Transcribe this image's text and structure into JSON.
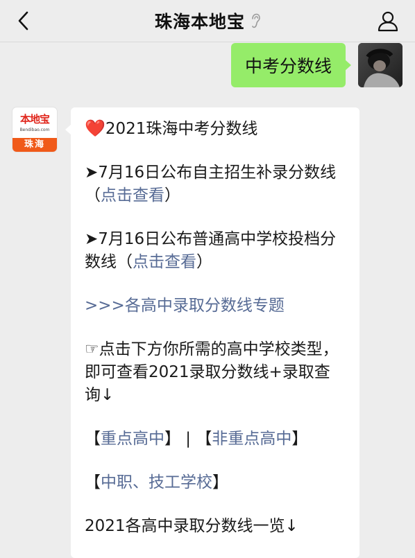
{
  "nav": {
    "title": "珠海本地宝",
    "back_icon": "chevron-left-icon",
    "ear_icon": "ear-icon",
    "profile_icon": "person-icon"
  },
  "outgoing": {
    "text": "中考分数线"
  },
  "bot": {
    "logo_top": "本地宝",
    "logo_url": "Bendibao.com",
    "logo_city": "珠海"
  },
  "message": {
    "heart": "❤️",
    "title": "2021珠海中考分数线",
    "item1_text": "➤7月16日公布自主招生补录分数线（",
    "item1_link": "点击查看",
    "item1_end": "）",
    "item2_text": "➤7月16日公布普通高中学校投档分数线（",
    "item2_link": "点击查看",
    "item2_end": "）",
    "topic_link": ">>>各高中录取分数线专题",
    "hint": "☞点击下方你所需的高中学校类型，即可查看2021录取分数线+录取查询↓",
    "cat_open1": "【",
    "cat_link1": "重点高中",
    "cat_close1": "】",
    "cat_sep": " | ",
    "cat_open2": "【",
    "cat_link2": "非重点高中",
    "cat_close2": "】",
    "cat_open3": "【",
    "cat_link3": "中职、技工学校",
    "cat_close3": "】",
    "overview": "2021各高中录取分数线一览↓"
  },
  "colors": {
    "link": "#576b95",
    "bubble_out": "#95ec69",
    "background": "#ededed"
  }
}
